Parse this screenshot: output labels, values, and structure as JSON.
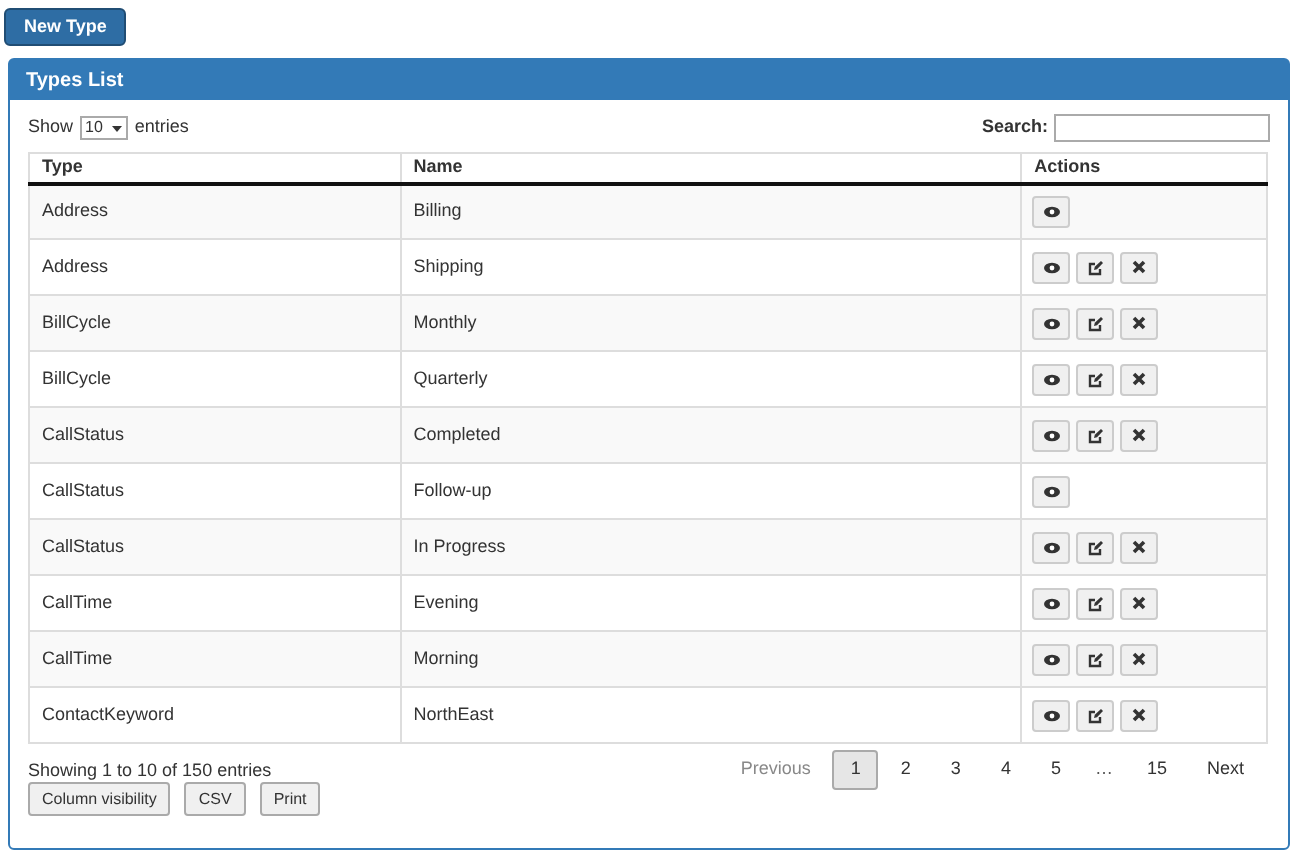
{
  "new_button": "New Type",
  "panel": {
    "title": "Types List"
  },
  "length": {
    "before": "Show",
    "value": "10",
    "after": "entries"
  },
  "search": {
    "label": "Search:"
  },
  "table": {
    "columns": [
      "Type",
      "Name",
      "Actions"
    ],
    "rows": [
      {
        "type": "Address",
        "name": "Billing",
        "actions": [
          {
            "kind": "view"
          }
        ]
      },
      {
        "type": "Address",
        "name": "Shipping",
        "actions": [
          {
            "kind": "view"
          },
          {
            "kind": "edit"
          },
          {
            "kind": "delete"
          }
        ]
      },
      {
        "type": "BillCycle",
        "name": "Monthly",
        "actions": [
          {
            "kind": "view"
          },
          {
            "kind": "edit"
          },
          {
            "kind": "delete"
          }
        ]
      },
      {
        "type": "BillCycle",
        "name": "Quarterly",
        "actions": [
          {
            "kind": "view"
          },
          {
            "kind": "edit"
          },
          {
            "kind": "delete"
          }
        ]
      },
      {
        "type": "CallStatus",
        "name": "Completed",
        "actions": [
          {
            "kind": "view"
          },
          {
            "kind": "edit"
          },
          {
            "kind": "delete"
          }
        ]
      },
      {
        "type": "CallStatus",
        "name": "Follow-up",
        "actions": [
          {
            "kind": "view"
          }
        ]
      },
      {
        "type": "CallStatus",
        "name": "In Progress",
        "actions": [
          {
            "kind": "view"
          },
          {
            "kind": "edit"
          },
          {
            "kind": "delete"
          }
        ]
      },
      {
        "type": "CallTime",
        "name": "Evening",
        "actions": [
          {
            "kind": "view"
          },
          {
            "kind": "edit"
          },
          {
            "kind": "delete"
          }
        ]
      },
      {
        "type": "CallTime",
        "name": "Morning",
        "actions": [
          {
            "kind": "view"
          },
          {
            "kind": "edit"
          },
          {
            "kind": "delete"
          }
        ]
      },
      {
        "type": "ContactKeyword",
        "name": "NorthEast",
        "actions": [
          {
            "kind": "view"
          },
          {
            "kind": "edit"
          },
          {
            "kind": "delete"
          }
        ]
      }
    ]
  },
  "info": "Showing 1 to 10 of 150 entries",
  "pagination": [
    {
      "label": "Previous",
      "kind": "link",
      "selected": false,
      "disabled": true
    },
    {
      "label": "1",
      "kind": "link",
      "selected": true,
      "disabled": false
    },
    {
      "label": "2",
      "kind": "link",
      "selected": false,
      "disabled": false
    },
    {
      "label": "3",
      "kind": "link",
      "selected": false,
      "disabled": false
    },
    {
      "label": "4",
      "kind": "link",
      "selected": false,
      "disabled": false
    },
    {
      "label": "5",
      "kind": "link",
      "selected": false,
      "disabled": false
    },
    {
      "label": "…",
      "kind": "ellipsis"
    },
    {
      "label": "15",
      "kind": "link",
      "selected": false,
      "disabled": false
    },
    {
      "label": "Next",
      "kind": "link",
      "selected": false,
      "disabled": false
    }
  ],
  "export_buttons": [
    "Column visibility",
    "CSV",
    "Print"
  ]
}
